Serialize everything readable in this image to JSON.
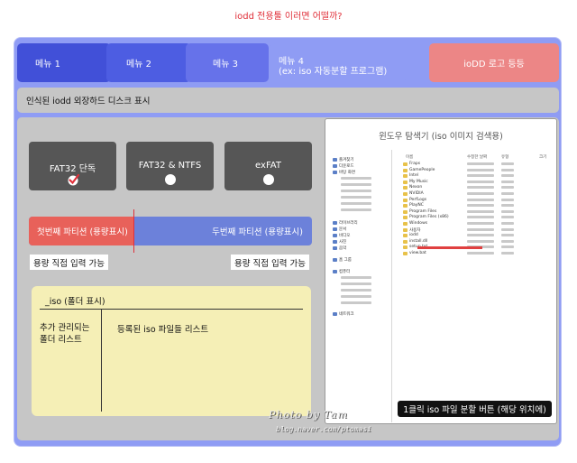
{
  "caption": "iodd 전용툴 이러면 어떨까?",
  "menus": {
    "m1": "메뉴 1",
    "m2": "메뉴 2",
    "m3": "메뉴 3",
    "m4_line1": "메뉴 4",
    "m4_line2": "(ex: iso 자동분할 프로그램)",
    "logo": "ioDD 로고 등등"
  },
  "disk_bar": "인식된 iodd 외장하드 디스크 표시",
  "filesystems": {
    "fat32": "FAT32 단독",
    "fat32_ntfs": "FAT32 & NTFS",
    "exfat": "exFAT",
    "selected": "fat32"
  },
  "partitions": {
    "first": "첫번째 파티션 (용량표시)",
    "second": "두번째 파티션 (용량표시)",
    "capacity_input_1": "용량 직접 입력 가능",
    "capacity_input_2": "용량 직접 입력 가능"
  },
  "iso_panel": {
    "title": "_iso (폴더 표시)",
    "folder_list": "추가 관리되는 폴더 리스트",
    "iso_list": "등록된 iso 파일들 리스트"
  },
  "explorer": {
    "title": "윈도우 탐색기 (iso 이미지 검색용)",
    "columns": {
      "name": "이름",
      "date": "수정한 날짜",
      "type": "유형",
      "size": "크기"
    },
    "nav_items": [
      "즐겨찾기",
      "다운로드",
      "바탕 화면",
      "라이브러리",
      "문서",
      "비디오",
      "사진",
      "음악",
      "홈 그룹",
      "컴퓨터",
      "네트워크"
    ],
    "files": [
      "Fraps",
      "GamePeople",
      "Intel",
      "My Music",
      "Nexon",
      "NVIDIA",
      "PerfLogs",
      "PlayNC",
      "Program Files",
      "Program Files (x86)",
      "Windows",
      "사용자",
      "iodd",
      "install.dll",
      "setup.txt",
      "view.bat"
    ]
  },
  "split_button": "1클릭 iso 파일 분할 버튼 (해당 위치에)",
  "watermark": {
    "line1": "Photo by Tam",
    "line2": "blog.naver.com/ptomasi"
  },
  "colors": {
    "frame": "#8f9cf4",
    "menu_logo": "#ec8686",
    "partition_first": "#e8615a",
    "partition_second": "#6c81da",
    "iso_panel": "#f5efb6"
  }
}
